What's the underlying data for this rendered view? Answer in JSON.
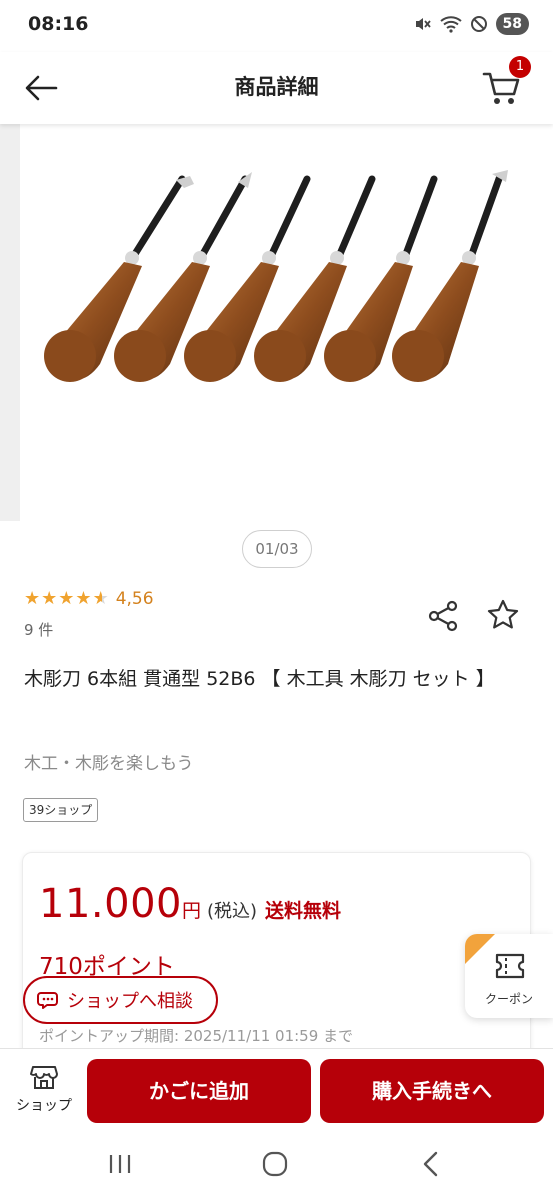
{
  "status_bar": {
    "time": "08:16",
    "battery": "58"
  },
  "header": {
    "title": "商品詳細",
    "cart_count": "1"
  },
  "gallery": {
    "counter": "01/03"
  },
  "rating": {
    "value": "4,56",
    "stars": 4.5,
    "review_count": "9 件"
  },
  "product": {
    "title": "木彫刀 6本組 貫通型 52B6 【 木工具 木彫刀 セット 】",
    "tagline": "木工・木彫を楽しもう",
    "shop_tag": "39ショップ"
  },
  "price": {
    "amount": "11.000",
    "unit": "円",
    "tax_note": "(税込)",
    "shipping": "送料無料",
    "points": "710ポイント",
    "point_period": "ポイントアップ期間: 2025/11/11 01:59 まで"
  },
  "consult": {
    "label": "ショップへ相談"
  },
  "coupon": {
    "label": "クーポン"
  },
  "action_bar": {
    "shop_label": "ショップ",
    "add_to_cart": "かごに追加",
    "checkout": "購入手続きへ"
  },
  "colors": {
    "brand_red": "#b60009",
    "star": "#f0a32f",
    "coupon_accent": "#f2a33c"
  }
}
